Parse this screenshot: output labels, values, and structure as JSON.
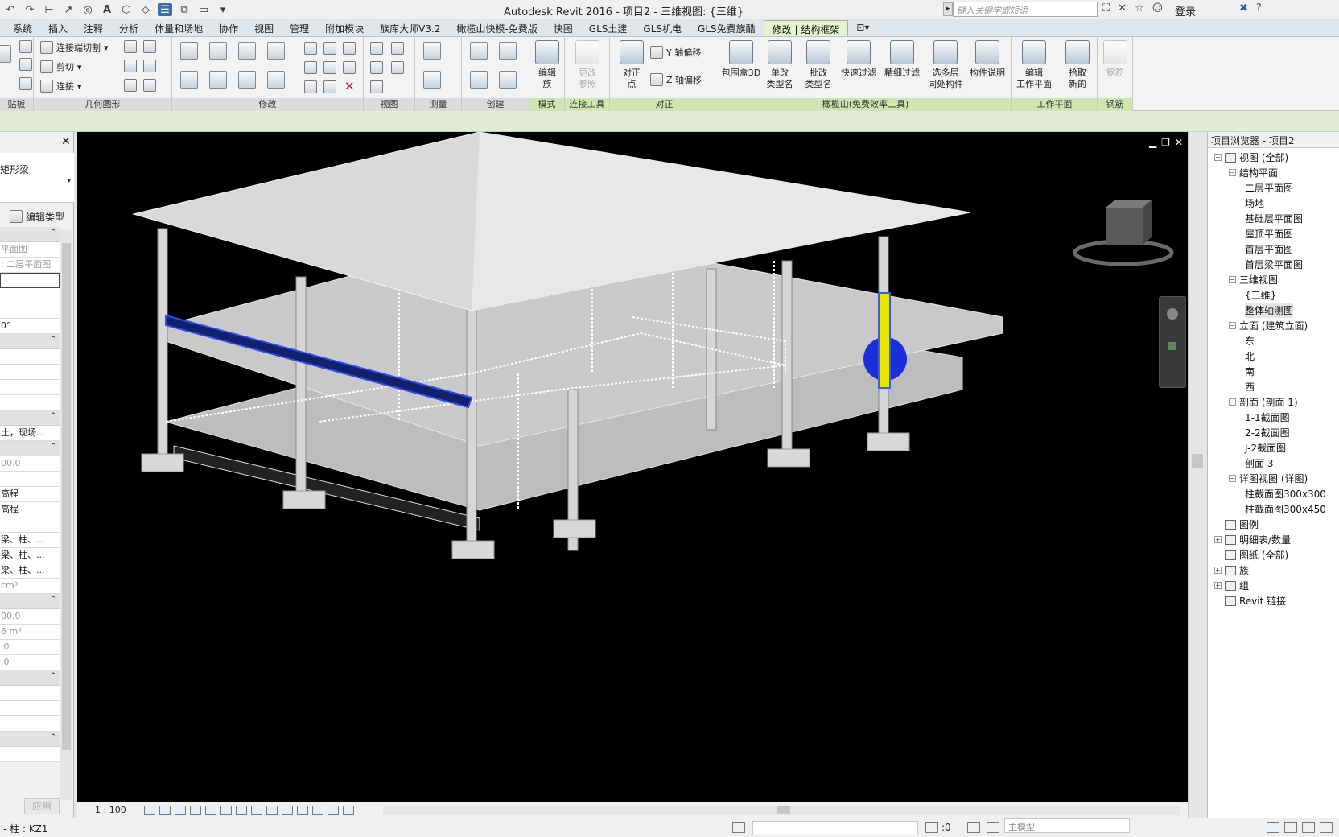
{
  "title_bar": {
    "title": "Autodesk Revit 2016 -     项目2 - 三维视图: {三维}",
    "search_placeholder": "键入关键字或短语",
    "login_label": "登录"
  },
  "ribbon": {
    "tabs": [
      "系统",
      "插入",
      "注释",
      "分析",
      "体量和场地",
      "协作",
      "视图",
      "管理",
      "附加模块",
      "族库大师V3.2",
      "橄榄山快模-免费版",
      "快图",
      "GLS土建",
      "GLS机电",
      "GLS免费族酷",
      "修改 | 结构框架"
    ],
    "active_tab": "修改 | 结构框架",
    "groups": {
      "clipboard": "贴板",
      "geometry": "几何图形",
      "modify": "修改",
      "view": "视图",
      "measure": "测量",
      "create": "创建",
      "mode": "模式",
      "connect_tools": "连接工具",
      "align": "对正",
      "olivemountain": "橄榄山(免费效率工具)",
      "workplane": "工作平面",
      "rebar": "钢筋"
    },
    "geometry_buttons": {
      "join_end_cut": "连接端切割",
      "cut": "剪切",
      "join": "连接"
    },
    "align_buttons": {
      "y_offset": "Y 轴偏移",
      "z_offset": "Z 轴偏移"
    },
    "big_buttons": [
      {
        "label": "编辑\n族",
        "disabled": false
      },
      {
        "label": "更改\n参照",
        "disabled": true
      },
      {
        "label": "对正\n点",
        "disabled": false
      },
      {
        "label": "包围盒3D",
        "disabled": false
      },
      {
        "label": "单改\n类型名",
        "disabled": false
      },
      {
        "label": "批改\n类型名",
        "disabled": false
      },
      {
        "label": "快速过滤",
        "disabled": false
      },
      {
        "label": "精细过滤",
        "disabled": false
      },
      {
        "label": "选多层\n同处构件",
        "disabled": false
      },
      {
        "label": "构件说明",
        "disabled": false
      },
      {
        "label": "编辑\n工作平面",
        "disabled": false
      },
      {
        "label": "拾取\n新的",
        "disabled": false
      },
      {
        "label": "钢筋",
        "disabled": true
      }
    ]
  },
  "properties": {
    "type_name": "矩形梁",
    "edit_type_label": "编辑类型",
    "rows": [
      {
        "text": "平面图",
        "grey": true
      },
      {
        "text": ": 二层平面图",
        "grey": true
      },
      {
        "text": "",
        "grey": false
      },
      {
        "text": "",
        "grey": false
      },
      {
        "text": "",
        "grey": false
      },
      {
        "text": "0°",
        "grey": false
      },
      {
        "text": "",
        "grey": false
      },
      {
        "text": "",
        "grey": false
      },
      {
        "text": "",
        "grey": false
      },
      {
        "text": "",
        "grey": false
      },
      {
        "text": "土，现场...",
        "grey": false
      },
      {
        "text": "00.0",
        "grey": true
      },
      {
        "text": "",
        "grey": false
      },
      {
        "text": "高程",
        "grey": false
      },
      {
        "text": "高程",
        "grey": false
      },
      {
        "text": "",
        "grey": false
      },
      {
        "text": "梁、柱、...",
        "grey": false
      },
      {
        "text": "梁、柱、...",
        "grey": false
      },
      {
        "text": "梁、柱、...",
        "grey": false
      },
      {
        "text": " cm³",
        "grey": true
      },
      {
        "text": "00.0",
        "grey": true
      },
      {
        "text": "6 m³",
        "grey": true
      },
      {
        "text": ".0",
        "grey": true
      },
      {
        "text": ".0",
        "grey": true
      }
    ],
    "apply_label": "应用"
  },
  "viewport": {
    "scale_label": "1 : 100"
  },
  "browser": {
    "title": "项目浏览器 - 项目2",
    "items": [
      {
        "label": "视图 (全部)",
        "level": 0,
        "exp": "-",
        "icon": true
      },
      {
        "label": "结构平面",
        "level": 1,
        "exp": "-"
      },
      {
        "label": "二层平面图",
        "level": 2
      },
      {
        "label": "场地",
        "level": 2
      },
      {
        "label": "基础层平面图",
        "level": 2
      },
      {
        "label": "屋顶平面图",
        "level": 2
      },
      {
        "label": "首层平面图",
        "level": 2
      },
      {
        "label": "首层梁平面图",
        "level": 2
      },
      {
        "label": "三维视图",
        "level": 1,
        "exp": "-"
      },
      {
        "label": "{三维}",
        "level": 2
      },
      {
        "label": "整体轴测图",
        "level": 2,
        "selected": true
      },
      {
        "label": "立面 (建筑立面)",
        "level": 1,
        "exp": "-"
      },
      {
        "label": "东",
        "level": 2
      },
      {
        "label": "北",
        "level": 2
      },
      {
        "label": "南",
        "level": 2
      },
      {
        "label": "西",
        "level": 2
      },
      {
        "label": "剖面 (剖面 1)",
        "level": 1,
        "exp": "-"
      },
      {
        "label": "1-1截面图",
        "level": 2
      },
      {
        "label": "2-2截面图",
        "level": 2
      },
      {
        "label": "J-2截面图",
        "level": 2
      },
      {
        "label": "剖面 3",
        "level": 2
      },
      {
        "label": "详图视图 (详图)",
        "level": 1,
        "exp": "-"
      },
      {
        "label": "柱截面图300x300",
        "level": 2
      },
      {
        "label": "柱截面图300x450",
        "level": 2
      },
      {
        "label": "图例",
        "level": 0,
        "icon": true
      },
      {
        "label": "明细表/数量",
        "level": 0,
        "exp": "+",
        "icon": true
      },
      {
        "label": "图纸 (全部)",
        "level": 0,
        "icon": true
      },
      {
        "label": "族",
        "level": 0,
        "exp": "+",
        "icon": true
      },
      {
        "label": "组",
        "level": 0,
        "exp": "+",
        "icon": true
      },
      {
        "label": "Revit 链接",
        "level": 0,
        "icon": true
      }
    ]
  },
  "status_bar": {
    "text": "- 柱 : KZ1",
    "zero_label": ":0",
    "model_label": "主模型"
  },
  "colors": {
    "ribbon_active_tab": "#e4f3d0",
    "viewport_bg": "#000000",
    "selection_blue": "#1a2fd9",
    "highlight_yellow": "#e6e600"
  }
}
